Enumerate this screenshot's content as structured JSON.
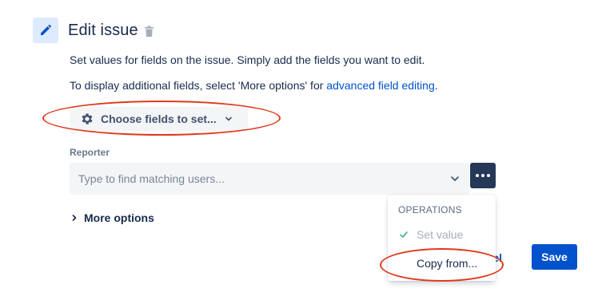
{
  "header": {
    "title": "Edit issue",
    "icon": "pencil-icon",
    "delete_icon": "trash-icon",
    "accent": "#deebff"
  },
  "description": {
    "line1": "Set values for fields on the issue. Simply add the fields you want to edit.",
    "line2_prefix": "To display additional fields, select 'More options' for ",
    "line2_link": "advanced field editing",
    "line2_suffix": "."
  },
  "choose_fields": {
    "label": "Choose fields to set...",
    "icon": "gear-icon"
  },
  "reporter": {
    "label": "Reporter",
    "placeholder": "Type to find matching users..."
  },
  "more_options": {
    "label": "More options"
  },
  "operations_menu": {
    "heading": "OPERATIONS",
    "items": [
      {
        "label": "Set value",
        "checked": true
      },
      {
        "label": "Copy from..."
      }
    ]
  },
  "footer": {
    "cancel_label_visible": "ncel",
    "save_label": "Save"
  },
  "colors": {
    "primary": "#0052cc",
    "text": "#172b4d",
    "subtle_bg": "#f4f5f7",
    "dark_button": "#253858",
    "annotation_red": "#e0391d"
  }
}
